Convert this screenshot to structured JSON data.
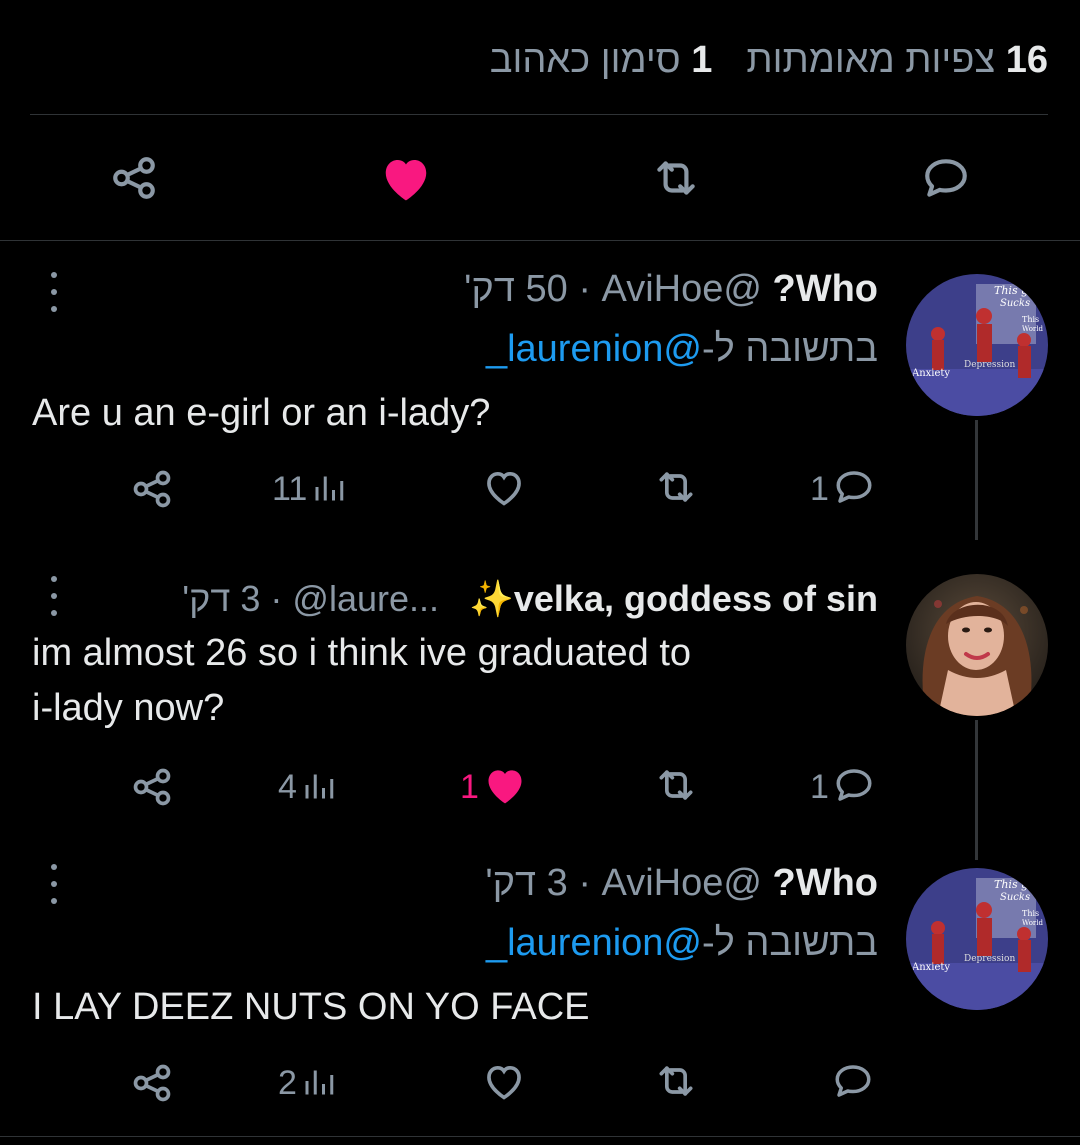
{
  "stats": {
    "views_count": "16",
    "views_label": "צפיות מאומתות",
    "likes_count": "1",
    "likes_label": "סימון כאהוב"
  },
  "colors": {
    "like": "#f91880",
    "mention": "#1d9bf0",
    "muted": "#8b98a5",
    "background": "#000000"
  },
  "main_actions": [
    "share-icon",
    "heart-filled-icon",
    "retweet-icon",
    "reply-icon"
  ],
  "replies": [
    {
      "name": "Who?",
      "handle": "@AviHoe",
      "separator": "·",
      "time": "50 דק'",
      "reply_prefix": "בתשובה ל-",
      "reply_to": "@laurenion_",
      "text": "Are u an e-girl or an i-lady?",
      "views": "11",
      "likes": "",
      "retweets": "",
      "replies": "1",
      "liked": false,
      "avatar_text": [
        "This guy",
        "Sucks",
        "This",
        "World",
        "Depression",
        "Anxiety"
      ]
    },
    {
      "name": "velka, goddess of sin✨",
      "handle": "@laure...",
      "separator": "·",
      "time": "3 דק'",
      "text_line1": "im almost 26 so i think ive graduated to",
      "text_line2": "i-lady now?",
      "views": "4",
      "likes": "1",
      "retweets": "",
      "replies": "1",
      "liked": true
    },
    {
      "name": "Who?",
      "handle": "@AviHoe",
      "separator": "·",
      "time": "3 דק'",
      "reply_prefix": "בתשובה ל-",
      "reply_to": "@laurenion_",
      "text": "I LAY DEEZ NUTS ON YO FACE",
      "views": "2",
      "likes": "",
      "retweets": "",
      "replies": "",
      "liked": false,
      "avatar_text": [
        "This guy",
        "Sucks",
        "This",
        "World",
        "Depression",
        "Anxiety"
      ]
    }
  ]
}
